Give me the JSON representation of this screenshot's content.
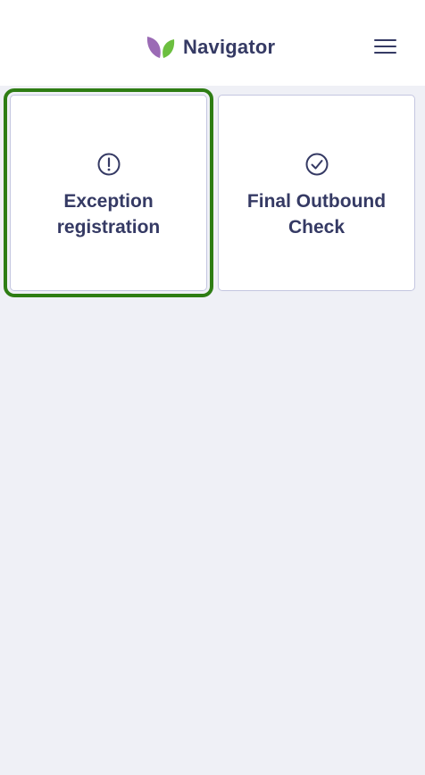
{
  "header": {
    "brand": "Navigator",
    "logo_icon": "leaf-logo-icon",
    "menu_icon": "hamburger-menu-icon"
  },
  "tiles": [
    {
      "label": "Exception registration",
      "icon": "exclamation-circle-icon",
      "focused": true
    },
    {
      "label": "Final Outbound Check",
      "icon": "check-circle-icon",
      "focused": false
    }
  ],
  "colors": {
    "text": "#353a64",
    "background": "#eff0f6",
    "card_border": "#c4c6e0",
    "focus_outline": "#2e7d14",
    "logo_left_leaf": "#9b6bb5",
    "logo_right_leaf": "#6cbf3f"
  }
}
